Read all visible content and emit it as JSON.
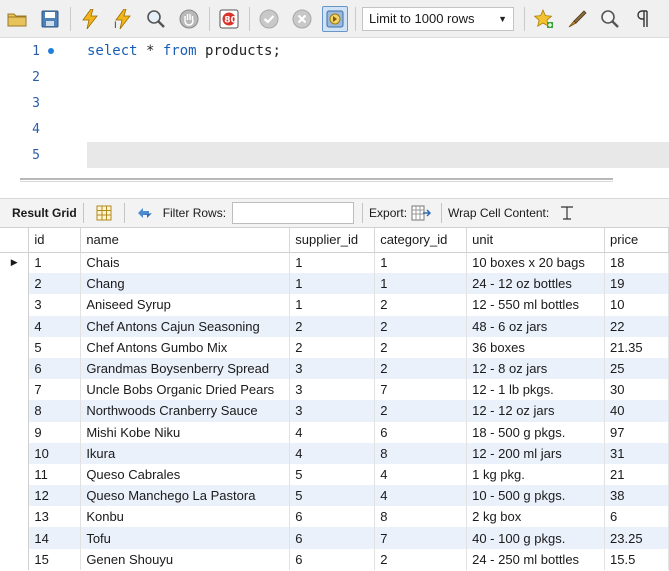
{
  "toolbar": {
    "buttons": [
      "open-sql-file",
      "save-sql",
      "execute",
      "execute-statement",
      "explain",
      "stop",
      "toggle-error-continue",
      "commit",
      "rollback",
      "autocommit"
    ],
    "limit_select": "Limit to 1000 rows",
    "right_buttons": [
      "add-snippet",
      "beautify",
      "find",
      "invisible-chars",
      "wrap"
    ]
  },
  "editor": {
    "lines": [
      {
        "num": "1",
        "has_dot": true,
        "keyword1": "select",
        "plain1": " * ",
        "keyword2": "from",
        "plain2": " products;"
      },
      {
        "num": "2"
      },
      {
        "num": "3"
      },
      {
        "num": "4"
      },
      {
        "num": "5"
      }
    ]
  },
  "result_bar": {
    "grid_label": "Result Grid",
    "filter_label": "Filter Rows:",
    "filter_value": "",
    "export_label": "Export:",
    "wrap_label": "Wrap Cell Content:"
  },
  "grid": {
    "columns": [
      "id",
      "name",
      "supplier_id",
      "category_id",
      "unit",
      "price"
    ],
    "rows": [
      [
        "1",
        "Chais",
        "1",
        "1",
        "10 boxes x 20 bags",
        "18"
      ],
      [
        "2",
        "Chang",
        "1",
        "1",
        "24 - 12 oz bottles",
        "19"
      ],
      [
        "3",
        "Aniseed Syrup",
        "1",
        "2",
        "12 - 550 ml bottles",
        "10"
      ],
      [
        "4",
        "Chef Antons Cajun Seasoning",
        "2",
        "2",
        "48 - 6 oz jars",
        "22"
      ],
      [
        "5",
        "Chef Antons Gumbo Mix",
        "2",
        "2",
        "36 boxes",
        "21.35"
      ],
      [
        "6",
        "Grandmas Boysenberry Spread",
        "3",
        "2",
        "12 - 8 oz jars",
        "25"
      ],
      [
        "7",
        "Uncle Bobs Organic Dried Pears",
        "3",
        "7",
        "12 - 1 lb pkgs.",
        "30"
      ],
      [
        "8",
        "Northwoods Cranberry Sauce",
        "3",
        "2",
        "12 - 12 oz jars",
        "40"
      ],
      [
        "9",
        "Mishi Kobe Niku",
        "4",
        "6",
        "18 - 500 g pkgs.",
        "97"
      ],
      [
        "10",
        "Ikura",
        "4",
        "8",
        "12 - 200 ml jars",
        "31"
      ],
      [
        "11",
        "Queso Cabrales",
        "5",
        "4",
        "1 kg pkg.",
        "21"
      ],
      [
        "12",
        "Queso Manchego La Pastora",
        "5",
        "4",
        "10 - 500 g pkgs.",
        "38"
      ],
      [
        "13",
        "Konbu",
        "6",
        "8",
        "2 kg box",
        "6"
      ],
      [
        "14",
        "Tofu",
        "6",
        "7",
        "40 - 100 g pkgs.",
        "23.25"
      ],
      [
        "15",
        "Genen Shouyu",
        "6",
        "2",
        "24 - 250 ml bottles",
        "15.5"
      ]
    ]
  }
}
